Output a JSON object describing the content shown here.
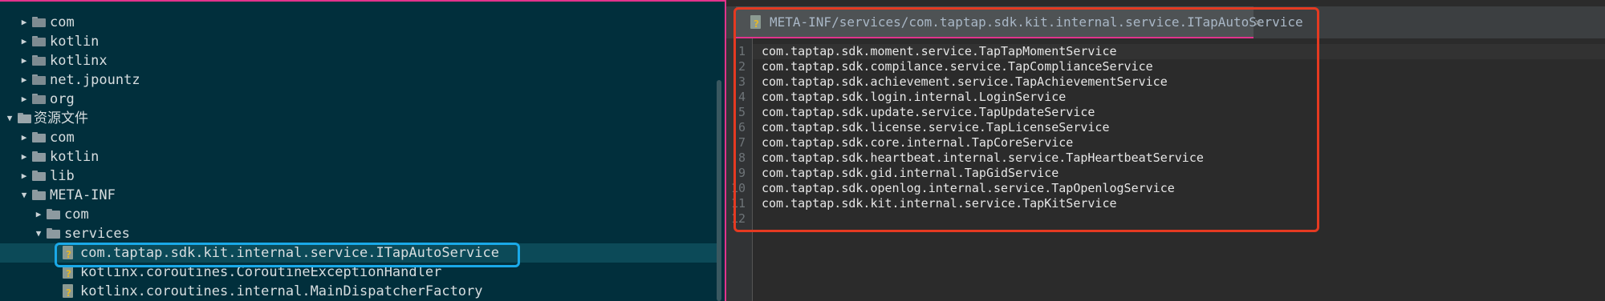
{
  "project_tree": {
    "items": [
      {
        "label": "com",
        "type": "package",
        "expanded": false
      },
      {
        "label": "kotlin",
        "type": "package",
        "expanded": false
      },
      {
        "label": "kotlinx",
        "type": "package",
        "expanded": false
      },
      {
        "label": "net.jpountz",
        "type": "package",
        "expanded": false
      },
      {
        "label": "org",
        "type": "package",
        "expanded": false
      },
      {
        "label": "资源文件",
        "type": "resources",
        "expanded": true
      },
      {
        "label": "com",
        "type": "folder",
        "expanded": false
      },
      {
        "label": "kotlin",
        "type": "folder",
        "expanded": false
      },
      {
        "label": "lib",
        "type": "folder",
        "expanded": false
      },
      {
        "label": "META-INF",
        "type": "folder",
        "expanded": true
      },
      {
        "label": "com",
        "type": "folder",
        "expanded": false
      },
      {
        "label": "services",
        "type": "folder",
        "expanded": true
      },
      {
        "label": "com.taptap.sdk.kit.internal.service.ITapAutoService",
        "type": "file",
        "selected": true
      },
      {
        "label": "kotlinx.coroutines.CoroutineExceptionHandler",
        "type": "file"
      },
      {
        "label": "kotlinx.coroutines.internal.MainDispatcherFactory",
        "type": "file"
      }
    ]
  },
  "editor": {
    "tab_title": "META-INF/services/com.taptap.sdk.kit.internal.service.ITapAutoService",
    "tab_close": "×",
    "lines": [
      "com.taptap.sdk.moment.service.TapTapMomentService",
      "com.taptap.sdk.compilance.service.TapComplianceService",
      "com.taptap.sdk.achievement.service.TapAchievementService",
      "com.taptap.sdk.login.internal.LoginService",
      "com.taptap.sdk.update.service.TapUpdateService",
      "com.taptap.sdk.license.service.TapLicenseService",
      "com.taptap.sdk.core.internal.TapCoreService",
      "com.taptap.sdk.heartbeat.internal.service.TapHeartbeatService",
      "com.taptap.sdk.gid.internal.TapGidService",
      "com.taptap.sdk.openlog.internal.service.TapOpenlogService",
      "com.taptap.sdk.kit.internal.service.TapKitService",
      ""
    ],
    "line_numbers": [
      "1",
      "2",
      "3",
      "4",
      "5",
      "6",
      "7",
      "8",
      "9",
      "10",
      "11",
      "12"
    ]
  },
  "colors": {
    "tree_background": "#012f3c",
    "editor_background": "#2b2b2b",
    "selection_highlight": "#1aa9e8",
    "editor_highlight": "#e53a21",
    "panel_border": "#e2338c"
  }
}
